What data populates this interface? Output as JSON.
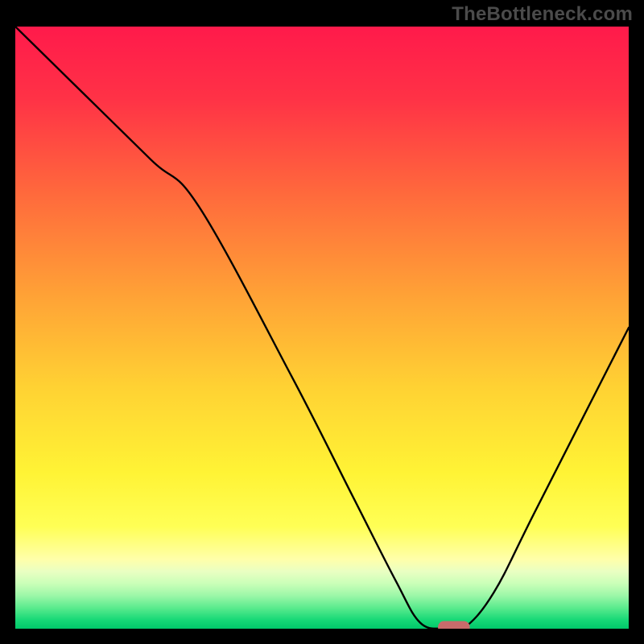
{
  "watermark": "TheBottleneck.com",
  "chart_data": {
    "type": "line",
    "title": "",
    "xlabel": "",
    "ylabel": "",
    "xlim": [
      0,
      100
    ],
    "ylim": [
      0,
      100
    ],
    "grid": false,
    "legend": false,
    "series": [
      {
        "name": "bottleneck-curve",
        "x": [
          0,
          8,
          22,
          30,
          45,
          55,
          62,
          66,
          70,
          73,
          78,
          85,
          100
        ],
        "values": [
          100,
          92,
          78,
          70,
          42,
          22,
          8,
          1,
          0,
          0,
          6,
          20,
          50
        ]
      }
    ],
    "marker": {
      "x": 71.5,
      "y": 0,
      "color": "#c86b6b",
      "radius_x": 2.6,
      "radius_y": 1.0
    },
    "gradient_stops": [
      {
        "offset": 0.0,
        "color": "#ff1a4b"
      },
      {
        "offset": 0.12,
        "color": "#ff3246"
      },
      {
        "offset": 0.28,
        "color": "#ff6a3c"
      },
      {
        "offset": 0.45,
        "color": "#ffa336"
      },
      {
        "offset": 0.6,
        "color": "#ffd233"
      },
      {
        "offset": 0.74,
        "color": "#fff335"
      },
      {
        "offset": 0.83,
        "color": "#ffff55"
      },
      {
        "offset": 0.885,
        "color": "#ffffaa"
      },
      {
        "offset": 0.905,
        "color": "#e9ffc2"
      },
      {
        "offset": 0.925,
        "color": "#caffb8"
      },
      {
        "offset": 0.945,
        "color": "#9cf7a8"
      },
      {
        "offset": 0.965,
        "color": "#5ceb8e"
      },
      {
        "offset": 0.985,
        "color": "#18d977"
      },
      {
        "offset": 1.0,
        "color": "#00c86a"
      }
    ]
  }
}
